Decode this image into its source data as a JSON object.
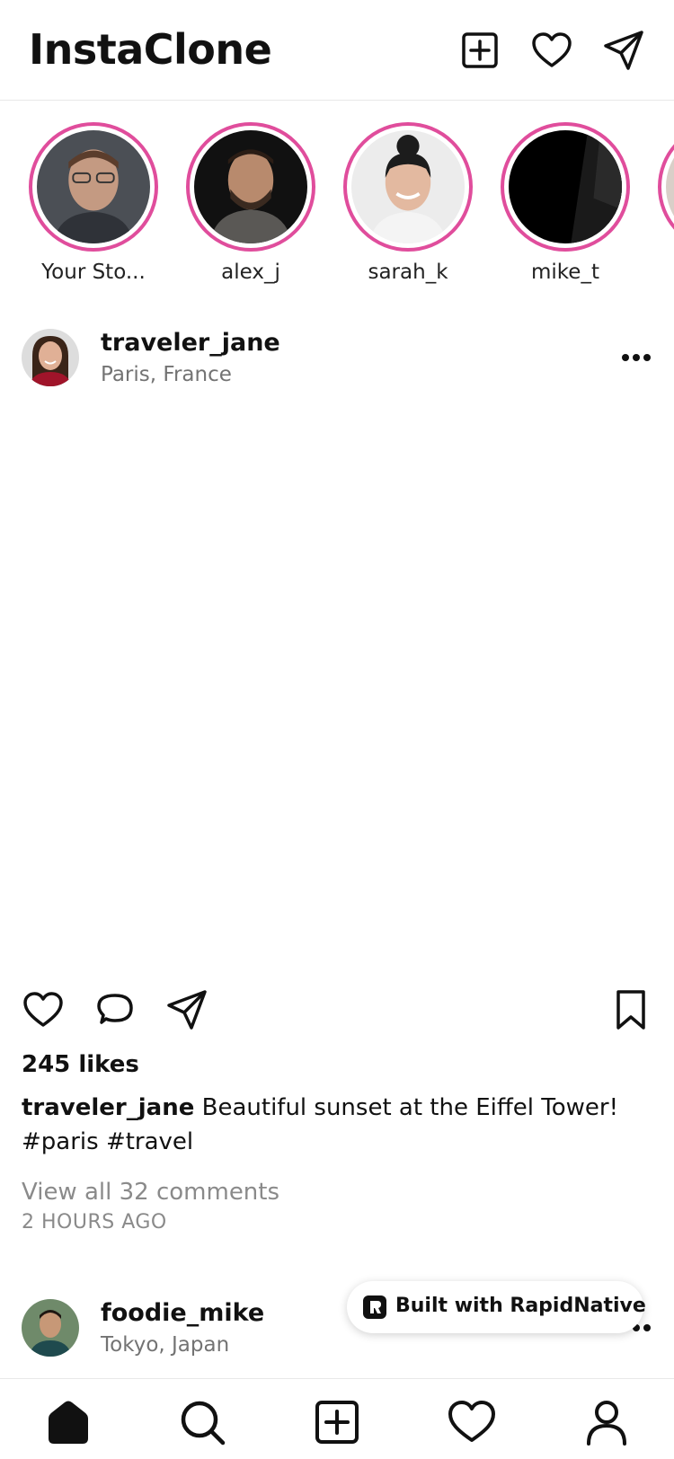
{
  "header": {
    "title": "InstaClone",
    "icons": [
      "add-post-icon",
      "heart-icon",
      "send-icon"
    ]
  },
  "stories": [
    {
      "name": "Your Sto...",
      "avatar": "avatar-man-glasses"
    },
    {
      "name": "alex_j",
      "avatar": "avatar-man-beard"
    },
    {
      "name": "sarah_k",
      "avatar": "avatar-woman-smile"
    },
    {
      "name": "mike_t",
      "avatar": "avatar-dark-abstract"
    }
  ],
  "posts": [
    {
      "username": "traveler_jane",
      "location": "Paris, France",
      "likes": "245 likes",
      "caption_user": "traveler_jane",
      "caption_text": " Beautiful sunset at the Eiffel Tower! #paris #travel",
      "view_comments": "View all 32 comments",
      "timestamp": "2 HOURS AGO"
    },
    {
      "username": "foodie_mike",
      "location": "Tokyo, Japan"
    }
  ],
  "badge": {
    "text": "Built with RapidNative"
  },
  "tabbar": {
    "items": [
      "home-icon",
      "search-icon",
      "add-post-icon",
      "heart-icon",
      "profile-icon"
    ]
  },
  "colors": {
    "story_ring": "#e04d9c",
    "text_primary": "#111111",
    "text_secondary": "#737373",
    "text_muted": "#8a8a8a"
  }
}
